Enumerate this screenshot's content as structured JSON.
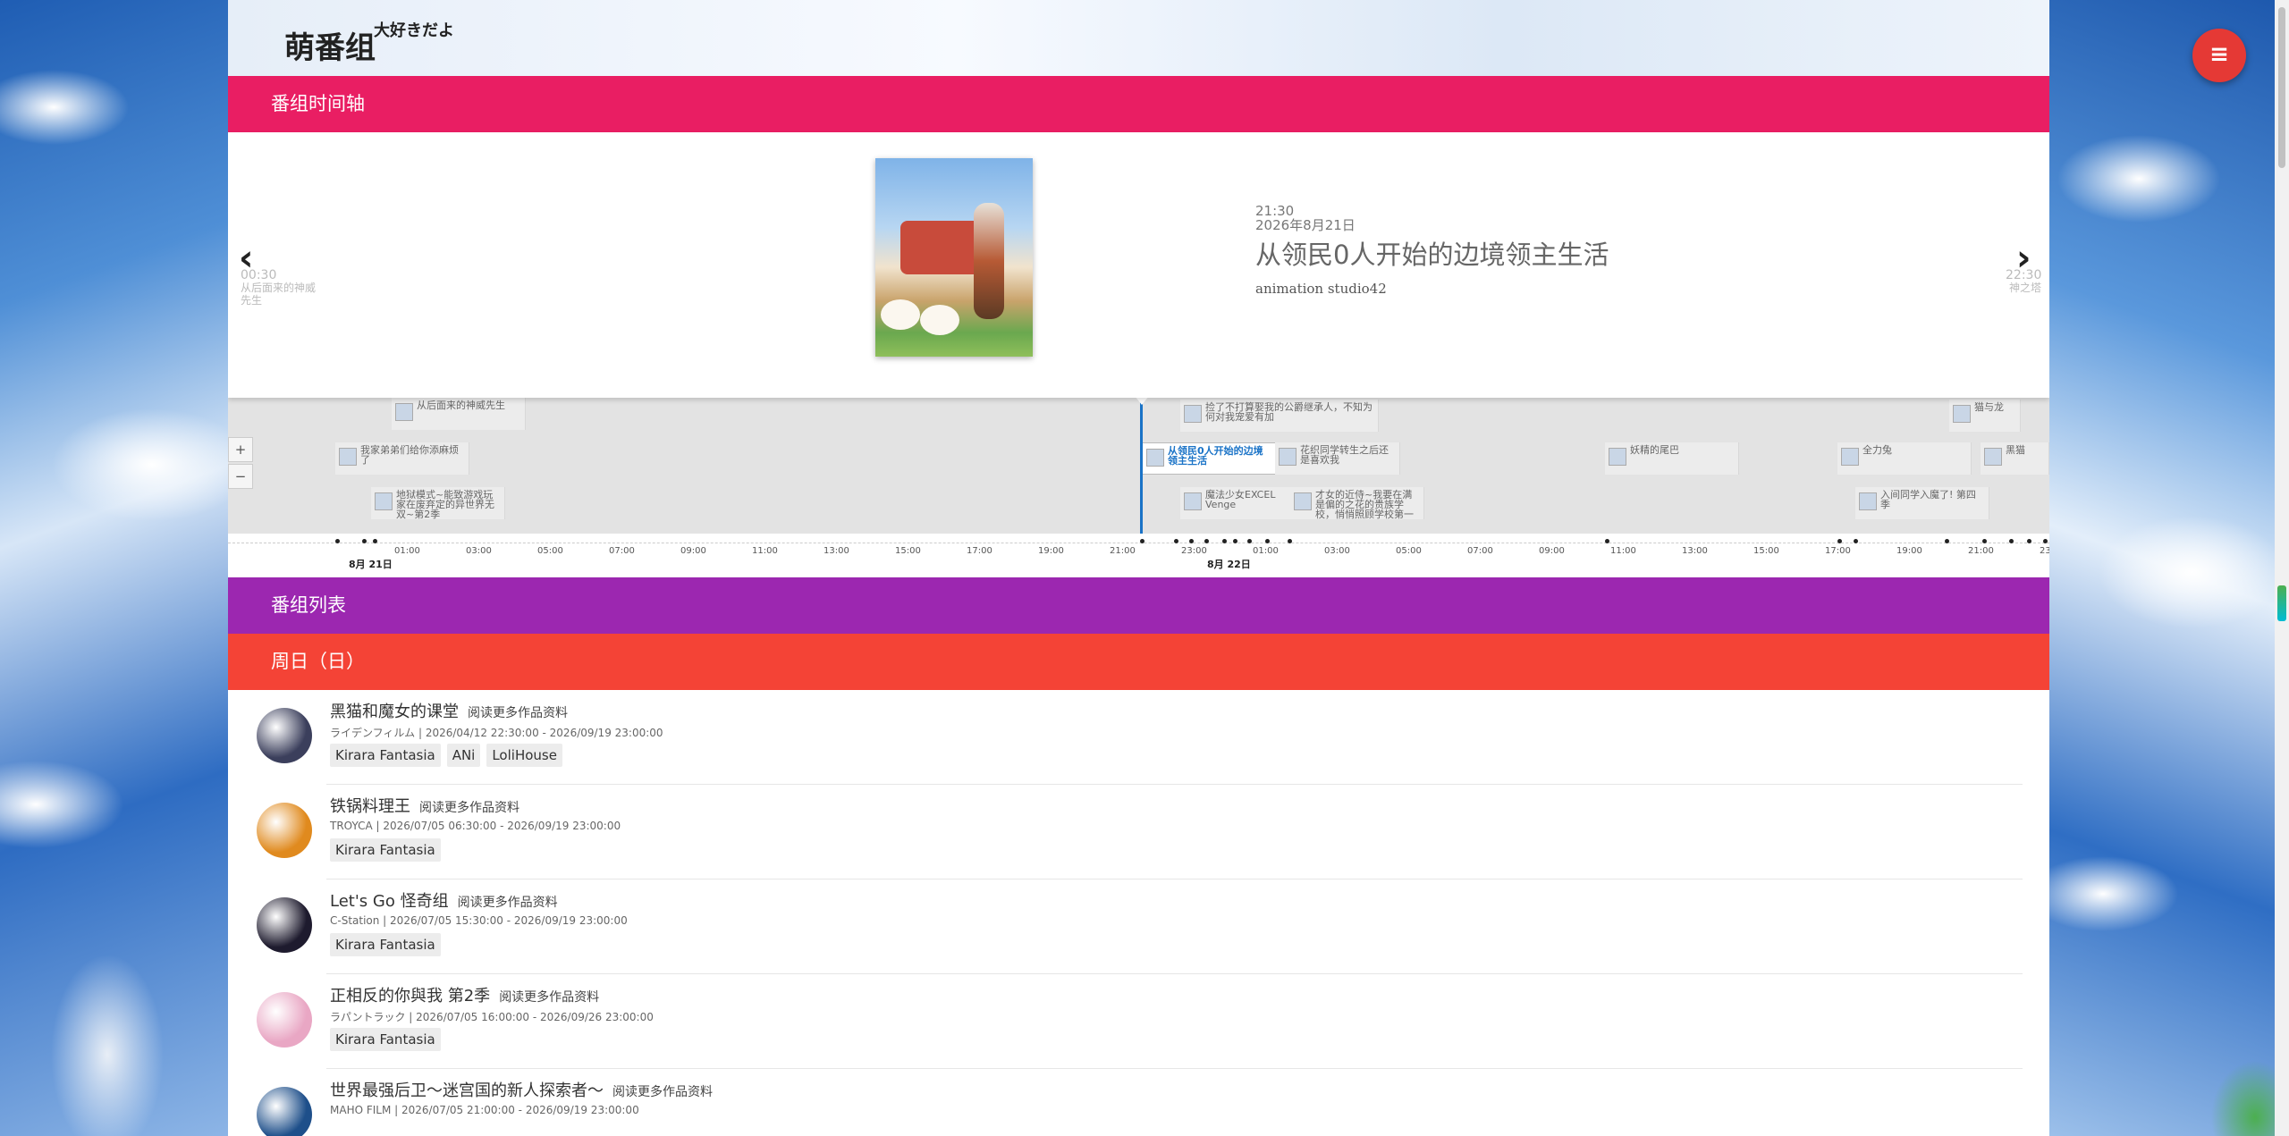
{
  "site": {
    "logo": "萌番组",
    "logo_sup": "大好きだよ"
  },
  "sections": {
    "timeline": "番组时间轴",
    "list": "番组列表",
    "day": "周日（日）"
  },
  "featured": {
    "time": "21:30",
    "date": "2026年8月21日",
    "title": "从领民0人开始的边境领主生活",
    "studio": "animation studio42"
  },
  "prev": {
    "arrow": "‹",
    "time": "00:30",
    "title": "从后面来的神威先生"
  },
  "next": {
    "arrow": "›",
    "time": "22:30",
    "title": "神之塔"
  },
  "timeline": {
    "zoom_in": "+",
    "zoom_out": "−",
    "events": {
      "e1": "从后面来的神威先生",
      "e2": "我家弟弟们给你添麻烦了",
      "e3": "地狱模式~能致游戏玩家在废弃定的异世界无双~第2季",
      "e4": "从领民0人开始的边境领主生活",
      "e5": "捡了不打算娶我的公爵继承人，不知为何对我宠爱有加",
      "e6": "花织同学转生之后还是喜欢我",
      "e7": "魔法少女EXCEL Venge",
      "e8": "才女的近侍~我要在满是偏的之花的贵族学校，悄悄照顾学校第一",
      "e9": "妖精的尾巴",
      "e10": "全力兔",
      "e11": "入间同学入魔了! 第四季",
      "e12": "猫与龙",
      "e13": "黑猫"
    },
    "ticks": [
      "01:00",
      "03:00",
      "05:00",
      "07:00",
      "09:00",
      "11:00",
      "13:00",
      "15:00",
      "17:00",
      "19:00",
      "21:00",
      "23:00",
      "01:00",
      "03:00",
      "05:00",
      "07:00",
      "09:00",
      "11:00",
      "13:00",
      "15:00",
      "17:00",
      "19:00",
      "21:00",
      "23"
    ],
    "day_labels": [
      "8月 21日",
      "8月 22日"
    ]
  },
  "items": [
    {
      "name": "黑猫和魔女的课堂",
      "more": "阅读更多作品资料",
      "meta": "ライデンフィルム | 2026/04/12 22:30:00 - 2026/09/19 23:00:00",
      "tags": [
        "Kirara Fantasia",
        "ANi",
        "LoliHouse"
      ],
      "avatar_color": "#3b3f5c"
    },
    {
      "name": "铁锅料理王",
      "more": "阅读更多作品资料",
      "meta": "TROYCA | 2026/07/05 06:30:00 - 2026/09/19 23:00:00",
      "tags": [
        "Kirara Fantasia"
      ],
      "avatar_color": "#e08a1e"
    },
    {
      "name": "Let's Go 怪奇组",
      "more": "阅读更多作品资料",
      "meta": "C-Station | 2026/07/05 15:30:00 - 2026/09/19 23:00:00",
      "tags": [
        "Kirara Fantasia"
      ],
      "avatar_color": "#1e1b2e"
    },
    {
      "name": "正相反的你與我 第2季",
      "more": "阅读更多作品资料",
      "meta": "ラパントラック | 2026/07/05 16:00:00 - 2026/09/26 23:00:00",
      "tags": [
        "Kirara Fantasia"
      ],
      "avatar_color": "#e9a7c4"
    },
    {
      "name": "世界最强后卫～迷宫国的新人探索者～",
      "more": "阅读更多作品资料",
      "meta": "MAHO FILM | 2026/07/05 21:00:00 - 2026/09/19 23:00:00",
      "tags": [],
      "avatar_color": "#1e4f8a"
    }
  ],
  "menu_icon": "menu-icon",
  "colors": {
    "timeline_bar": "#e91e63",
    "list_bar": "#9c27b0",
    "day_bar": "#f44336",
    "fab": "#e53935",
    "active": "#1a73c7"
  }
}
